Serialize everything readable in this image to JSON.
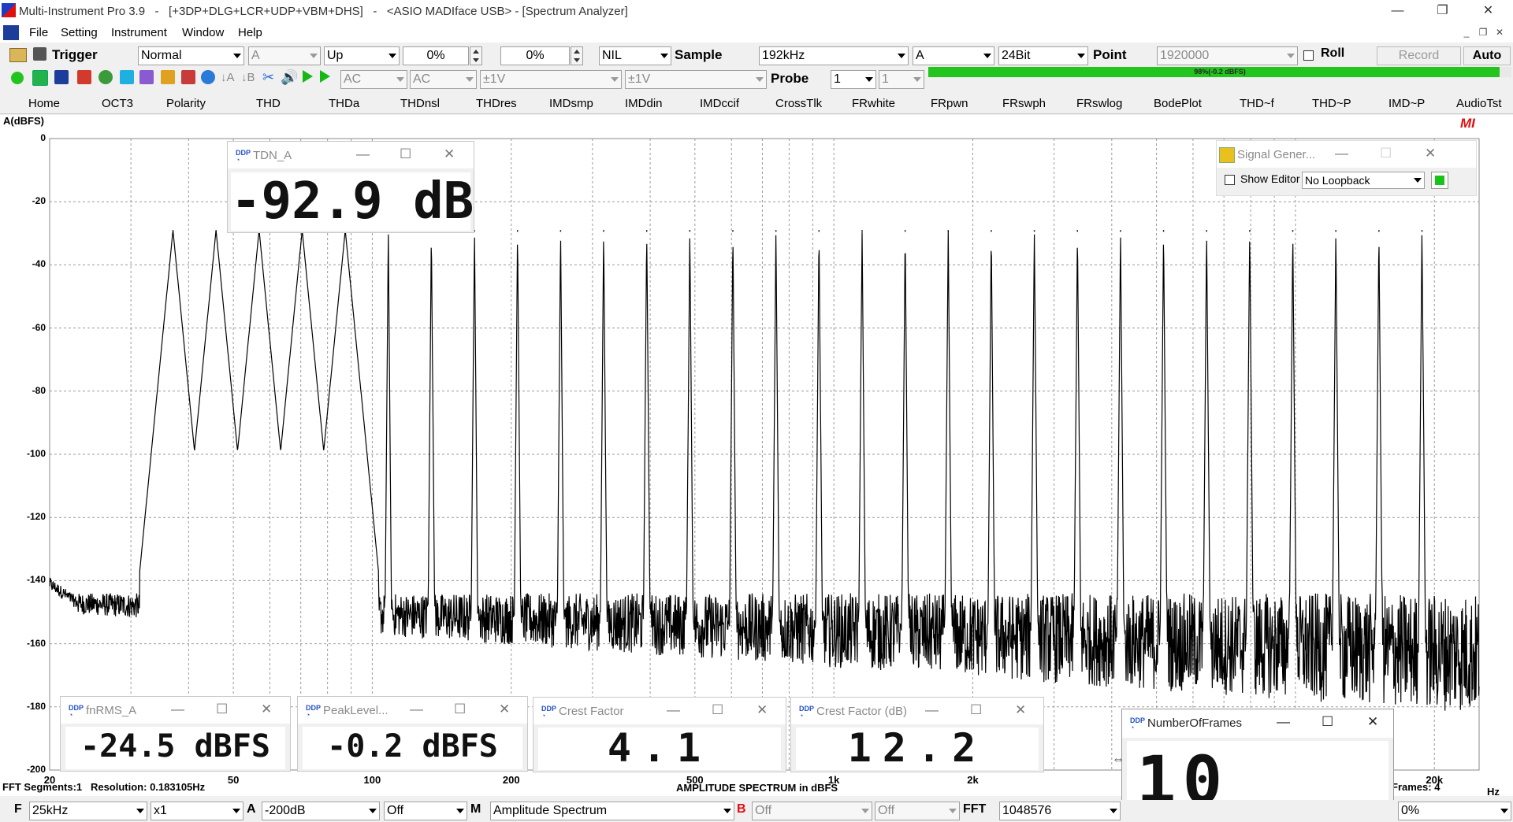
{
  "window": {
    "title": "Multi-Instrument Pro 3.9   -   [+3DP+DLG+LCR+UDP+VBM+DHS]   -   <ASIO MADIface USB> - [Spectrum Analyzer]",
    "minimize": "—",
    "restore": "❐",
    "close": "✕"
  },
  "menu": {
    "items": [
      "File",
      "Setting",
      "Instrument",
      "Window",
      "Help"
    ],
    "mdi_min": "_",
    "mdi_restore": "❐",
    "mdi_close": "✕"
  },
  "toolbar1": {
    "trigger": "Trigger",
    "trigger_mode": "Normal",
    "trigger_channel": "A",
    "trigger_edge": "Up",
    "pct1": "0%",
    "pct2": "0%",
    "nil": "NIL",
    "sample_label": "Sample",
    "sample_rate": "192kHz",
    "sample_channel": "A",
    "bits": "24Bit",
    "point_label": "Point",
    "points": "1920000",
    "roll": "Roll",
    "record": "Record",
    "auto": "Auto"
  },
  "toolbar2": {
    "coupling_a": "AC",
    "coupling_b": "AC",
    "range_a": "±1V",
    "range_b": "±1V",
    "probe_label": "Probe",
    "probe_a": "1",
    "probe_b": "1",
    "level_text": "98%(-0.2 dBFS)",
    "level_percent": 98
  },
  "tabs": [
    "Home",
    "OCT3",
    "Polarity",
    "THD",
    "THDa",
    "THDnsl",
    "THDres",
    "IMDsmp",
    "IMDdin",
    "IMDccif",
    "CrossTlk",
    "FRwhite",
    "FRpwn",
    "FRswph",
    "FRswlog",
    "BodePlot",
    "THD~f",
    "THD~P",
    "IMD~P",
    "AudioTst"
  ],
  "chart_data": {
    "type": "line",
    "title": "AMPLITUDE SPECTRUM in dBFS",
    "ylabel": "A(dBFS)",
    "xlabel": "Hz",
    "x_scale": "log",
    "xlim": [
      20,
      25000
    ],
    "ylim": [
      -200,
      0
    ],
    "y_ticks": [
      "0",
      "-20",
      "-40",
      "-60",
      "-80",
      "-100",
      "-120",
      "-140",
      "-160",
      "-180",
      "-200"
    ],
    "x_ticks": [
      "20",
      "50",
      "100",
      "200",
      "500",
      "1k",
      "2k",
      "20k"
    ],
    "grid": true,
    "series": [
      {
        "peaks_db": -29,
        "noise_floor_start_db": -147,
        "noise_floor_end_db": -163,
        "harmonic_count": 30
      }
    ],
    "info_left": "FFT Segments:1   Resolution: 0.183105Hz",
    "info_right": "Frames: 4",
    "mi_logo": "MI"
  },
  "panels": {
    "tdn": {
      "title": "TDN_A",
      "value": "-92.9 dB"
    },
    "fnrms": {
      "title": "fnRMS_A",
      "value": "-24.5 dBFS"
    },
    "peak": {
      "title": "PeakLevel...",
      "value": "-0.2 dBFS"
    },
    "crest": {
      "title": "Crest Factor",
      "value": "4.1"
    },
    "crestdb": {
      "title": "Crest Factor (dB)",
      "value": "12.2"
    },
    "frames": {
      "title": "NumberOfFrames",
      "value": "10"
    },
    "siggen": {
      "title": "Signal Gener...",
      "show_editor": "Show Editor",
      "loopback": "No Loopback"
    }
  },
  "bottombar": {
    "f_label": "F",
    "freq_range": "25kHz",
    "zoom": "x1",
    "a_label": "A",
    "a_floor": "-200dB",
    "a_off": "Off",
    "m_label": "M",
    "mode": "Amplitude Spectrum",
    "b_label": "B",
    "b_off1": "Off",
    "b_off2": "Off",
    "fft_label": "FFT",
    "fft_size": "1048576",
    "overlap": "0%"
  },
  "colors": {
    "accent_red": "#e01010",
    "level_green": "#22c51e",
    "trace": "#000000"
  }
}
